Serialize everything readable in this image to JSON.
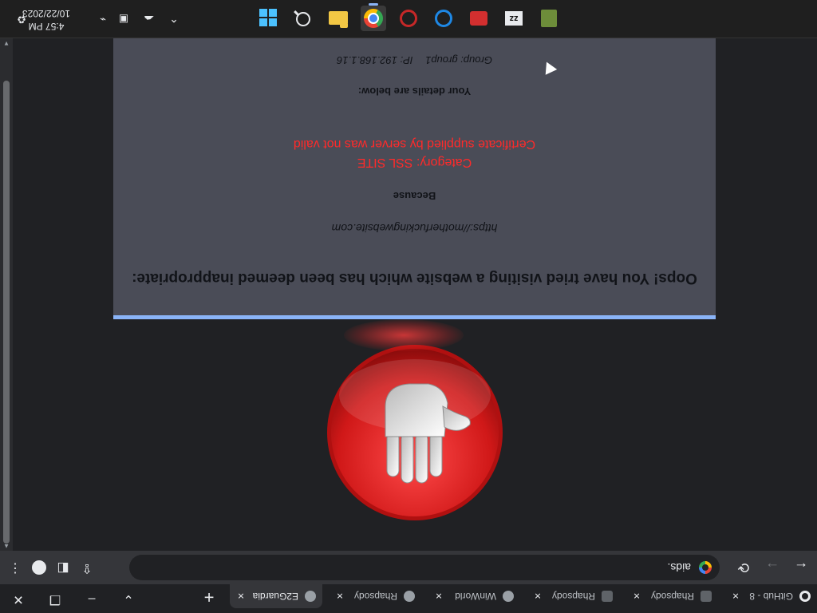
{
  "browser": {
    "tabs": [
      {
        "label": "GitHub - 8",
        "icon": "github-icon",
        "active": false
      },
      {
        "label": "Rhapsody",
        "icon": "music-icon",
        "active": false
      },
      {
        "label": "Rhapsody",
        "icon": "music-icon",
        "active": false
      },
      {
        "label": "WinWorld",
        "icon": "globe-icon",
        "active": false
      },
      {
        "label": "Rhapsody",
        "icon": "globe-icon",
        "active": false
      },
      {
        "label": "E2Guardia",
        "icon": "globe-icon",
        "active": true
      }
    ],
    "address": "aids.",
    "new_tab": "+",
    "close_glyph": "×"
  },
  "page": {
    "heading": "Oops! You have tried visiting a website which has been deemed inappropriate:",
    "blocked_url": "https://motherfuckingwebsite.com",
    "because": "Because",
    "category": "Category: SSL SITE",
    "reason": "Certificate supplied by server was not valid",
    "details_heading": "Your details are below:",
    "group": "Group: group1",
    "ip": "IP: 192.168.1.16",
    "colors": {
      "accent_line": "#8ab4f8",
      "warning": "#ff2a2a",
      "card_bg": "#4a4c57"
    }
  },
  "taskbar": {
    "time": "4:57 PM",
    "date": "10/22/2023",
    "tray_label": "zz"
  }
}
